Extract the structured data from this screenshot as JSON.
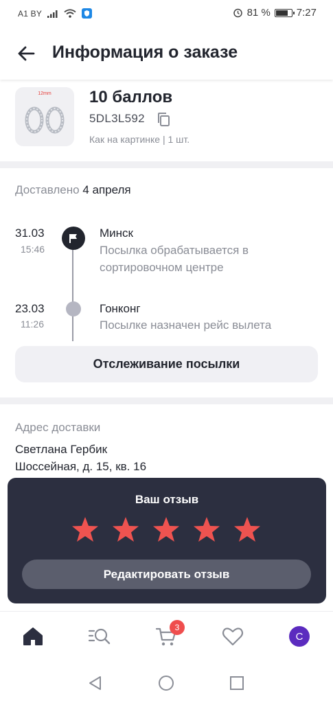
{
  "status_bar": {
    "carrier": "A1 BY",
    "battery_percent": "81 %",
    "battery_level": 0.81,
    "time": "7:27"
  },
  "header": {
    "title": "Информация о заказе",
    "back_icon": "arrow-left-icon"
  },
  "product": {
    "name": "10 баллов",
    "id": "5DL3L592",
    "variant": "Как на картинке | 1 шт.",
    "thumb_size_label": "12mm",
    "copy_icon": "copy-icon"
  },
  "delivery": {
    "status_label": "Доставлено",
    "status_date": "4 апреля"
  },
  "tracking": {
    "events": [
      {
        "date": "31.03",
        "time": "15:46",
        "city": "Минск",
        "description": "Посылка обрабатывается в сортировочном центре",
        "marker": "flag-icon"
      },
      {
        "date": "23.03",
        "time": "11:26",
        "city": "Гонконг",
        "description": "Посылке назначен рейс вылета",
        "marker": "dot"
      }
    ],
    "button_label": "Отслеживание посылки"
  },
  "address": {
    "label": "Адрес доставки",
    "recipient": "Светлана Гербик",
    "street": "Шоссейная, д. 15, кв. 16"
  },
  "review": {
    "title": "Ваш отзыв",
    "rating": 5,
    "max_rating": 5,
    "edit_button_label": "Редактировать отзыв",
    "star_color": "#ef5350"
  },
  "bottom_nav": {
    "items": [
      "home-icon",
      "search-catalog-icon",
      "cart-icon",
      "heart-icon",
      "profile-avatar"
    ],
    "cart_badge": "3",
    "avatar_letter": "С",
    "avatar_color": "#5b2bbf"
  },
  "system_nav": {
    "items": [
      "back-triangle-icon",
      "home-circle-icon",
      "recents-square-icon"
    ]
  }
}
